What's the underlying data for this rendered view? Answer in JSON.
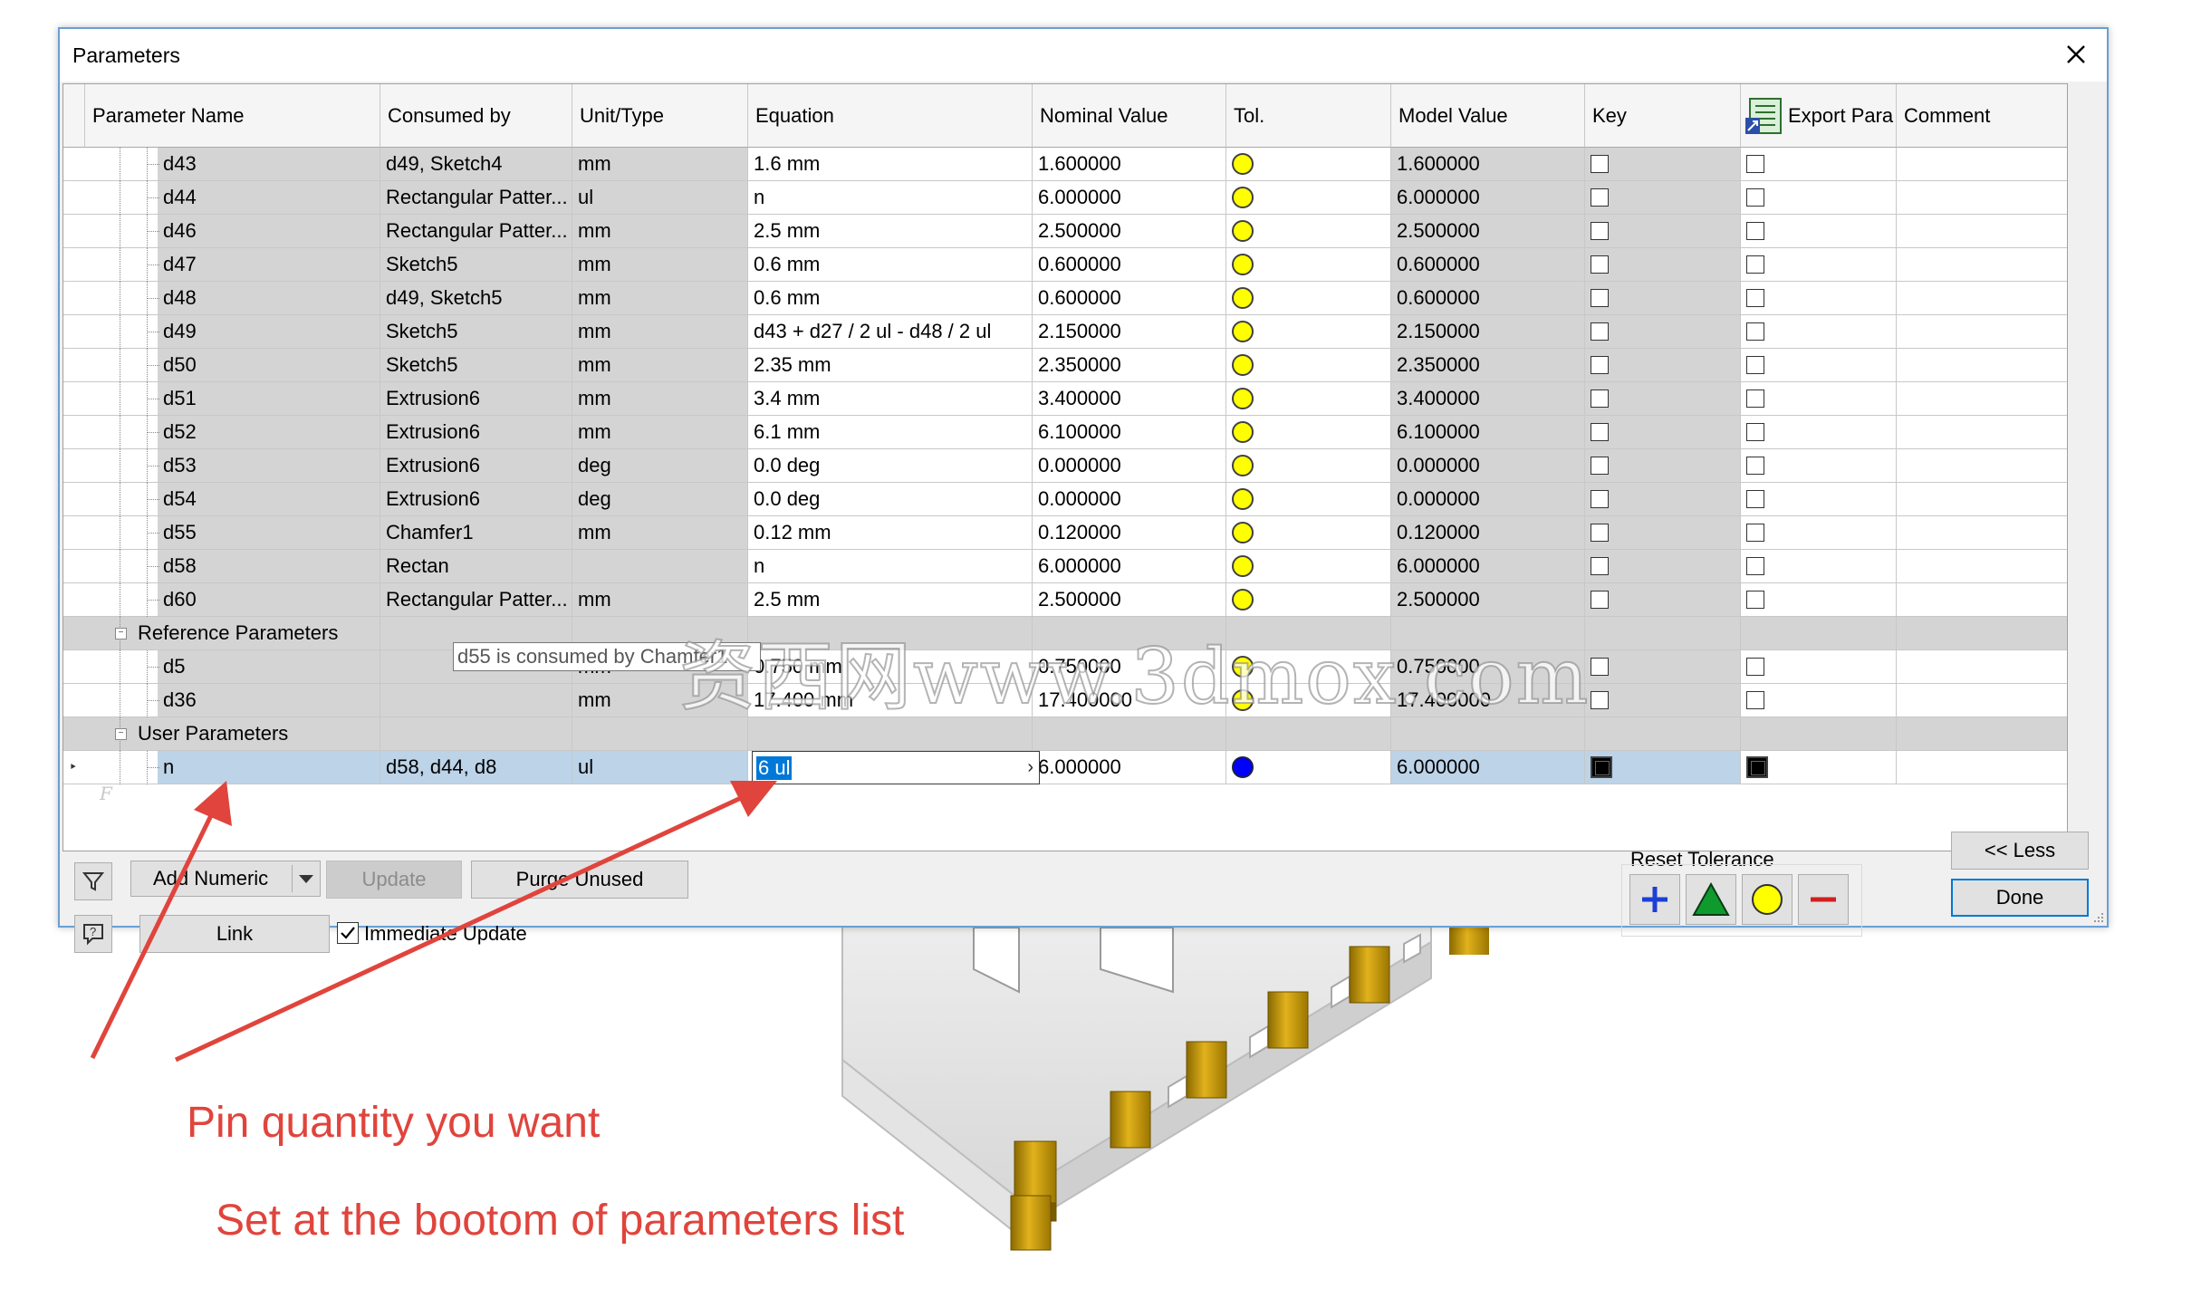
{
  "dialog": {
    "title": "Parameters"
  },
  "columns": [
    {
      "key": "name",
      "label": "Parameter Name"
    },
    {
      "key": "consumed",
      "label": "Consumed by"
    },
    {
      "key": "unit",
      "label": "Unit/Type"
    },
    {
      "key": "equation",
      "label": "Equation"
    },
    {
      "key": "nominal",
      "label": "Nominal Value"
    },
    {
      "key": "tol",
      "label": "Tol."
    },
    {
      "key": "model",
      "label": "Model Value"
    },
    {
      "key": "key",
      "label": "Key"
    },
    {
      "key": "export",
      "label": "Export Para"
    },
    {
      "key": "comment",
      "label": "Comment"
    }
  ],
  "model_rows": [
    {
      "name": "d43",
      "consumed": "d49, Sketch4",
      "unit": "mm",
      "equation": "1.6 mm",
      "nominal": "1.600000",
      "model": "1.600000"
    },
    {
      "name": "d44",
      "consumed": "Rectangular Patter...",
      "unit": "ul",
      "equation": "n",
      "nominal": "6.000000",
      "model": "6.000000"
    },
    {
      "name": "d46",
      "consumed": "Rectangular Patter...",
      "unit": "mm",
      "equation": "2.5 mm",
      "nominal": "2.500000",
      "model": "2.500000"
    },
    {
      "name": "d47",
      "consumed": "Sketch5",
      "unit": "mm",
      "equation": "0.6 mm",
      "nominal": "0.600000",
      "model": "0.600000"
    },
    {
      "name": "d48",
      "consumed": "d49, Sketch5",
      "unit": "mm",
      "equation": "0.6 mm",
      "nominal": "0.600000",
      "model": "0.600000"
    },
    {
      "name": "d49",
      "consumed": "Sketch5",
      "unit": "mm",
      "equation": "d43 + d27 / 2 ul - d48 / 2 ul",
      "nominal": "2.150000",
      "model": "2.150000"
    },
    {
      "name": "d50",
      "consumed": "Sketch5",
      "unit": "mm",
      "equation": "2.35 mm",
      "nominal": "2.350000",
      "model": "2.350000"
    },
    {
      "name": "d51",
      "consumed": "Extrusion6",
      "unit": "mm",
      "equation": "3.4 mm",
      "nominal": "3.400000",
      "model": "3.400000"
    },
    {
      "name": "d52",
      "consumed": "Extrusion6",
      "unit": "mm",
      "equation": "6.1 mm",
      "nominal": "6.100000",
      "model": "6.100000"
    },
    {
      "name": "d53",
      "consumed": "Extrusion6",
      "unit": "deg",
      "equation": "0.0 deg",
      "nominal": "0.000000",
      "model": "0.000000"
    },
    {
      "name": "d54",
      "consumed": "Extrusion6",
      "unit": "deg",
      "equation": "0.0 deg",
      "nominal": "0.000000",
      "model": "0.000000"
    },
    {
      "name": "d55",
      "consumed": "Chamfer1",
      "unit": "mm",
      "equation": "0.12 mm",
      "nominal": "0.120000",
      "model": "0.120000"
    },
    {
      "name": "d58",
      "consumed": "Rectan",
      "unit": "",
      "equation": "n",
      "nominal": "6.000000",
      "model": "6.000000"
    },
    {
      "name": "d60",
      "consumed": "Rectangular Patter...",
      "unit": "mm",
      "equation": "2.5 mm",
      "nominal": "2.500000",
      "model": "2.500000"
    }
  ],
  "reference_group": {
    "label": "Reference Parameters"
  },
  "reference_rows": [
    {
      "name": "d5",
      "consumed": "",
      "unit": "mm",
      "equation": "0.750 mm",
      "nominal": "0.750000",
      "model": "0.750000"
    },
    {
      "name": "d36",
      "consumed": "",
      "unit": "mm",
      "equation": "17.400 mm",
      "nominal": "17.400000",
      "model": "17.400000"
    }
  ],
  "user_group": {
    "label": "User Parameters"
  },
  "user_rows": [
    {
      "name": "n",
      "consumed": "d58, d44, d8",
      "unit": "ul",
      "equation": "6 ul",
      "nominal": "6.000000",
      "model": "6.000000",
      "edit_arrow": "›"
    }
  ],
  "row_marker": "‣",
  "tooltip": "d55 is consumed by Chamfer1",
  "buttons": {
    "add_numeric": "Add Numeric",
    "update": "Update",
    "purge_unused": "Purge Unused",
    "link": "Link",
    "immediate_update": "Immediate Update",
    "less": "<< Less",
    "done": "Done"
  },
  "reset_tolerance": {
    "label": "Reset Tolerance"
  },
  "colors": {
    "accent": "#0078d7",
    "annotation": "#e0443c",
    "tol_yellow": "#ffff00",
    "tol_blue": "#0000ff"
  },
  "annotations": {
    "line1": "Pin quantity you want",
    "line2": "Set at the bootom of parameters list"
  },
  "watermark": "资西网www.3dmox.com"
}
